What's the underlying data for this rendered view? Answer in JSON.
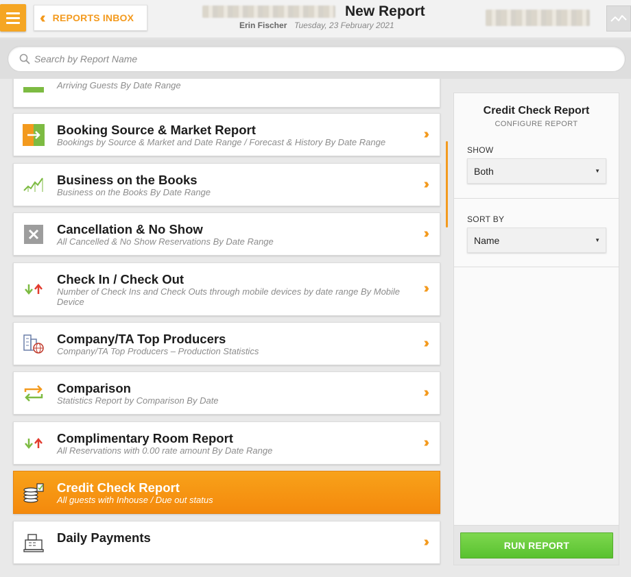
{
  "header": {
    "back_label": "REPORTS INBOX",
    "title": "New Report",
    "user": "Erin Fischer",
    "date": "Tuesday, 23 February 2021"
  },
  "search": {
    "placeholder": "Search by Report Name"
  },
  "reports": [
    {
      "title": "",
      "desc": "Arriving Guests By Date Range",
      "icon": "green-bar-icon"
    },
    {
      "title": "Booking Source & Market Report",
      "desc": "Bookings by Source & Market and Date Range / Forecast & History By Date Range",
      "icon": "booking-source-icon"
    },
    {
      "title": "Business on the Books",
      "desc": "Business on the Books By Date Range",
      "icon": "trend-chart-icon"
    },
    {
      "title": "Cancellation & No Show",
      "desc": "All Cancelled & No Show Reservations By Date Range",
      "icon": "cancel-x-icon"
    },
    {
      "title": "Check In / Check Out",
      "desc": "Number of Check Ins and Check Outs through mobile devices by date range By Mobile Device",
      "icon": "up-down-arrows-icon"
    },
    {
      "title": "Company/TA Top Producers",
      "desc": "Company/TA Top Producers – Production Statistics",
      "icon": "company-globe-icon"
    },
    {
      "title": "Comparison",
      "desc": "Statistics Report by Comparison By Date",
      "icon": "compare-arrows-icon"
    },
    {
      "title": "Complimentary Room Report",
      "desc": "All Reservations with 0.00 rate amount By Date Range",
      "icon": "up-down-arrows-icon"
    },
    {
      "title": "Credit Check Report",
      "desc": "All guests with Inhouse / Due out status",
      "icon": "coins-icon",
      "active": true
    },
    {
      "title": "Daily Payments",
      "desc": "",
      "icon": "cash-register-icon"
    }
  ],
  "panel": {
    "title": "Credit Check Report",
    "subtitle": "CONFIGURE REPORT",
    "show_label": "SHOW",
    "show_value": "Both",
    "sort_label": "SORT BY",
    "sort_value": "Name",
    "run_label": "RUN REPORT"
  },
  "colors": {
    "accent": "#f39a1e",
    "run_button": "#5fc535"
  }
}
